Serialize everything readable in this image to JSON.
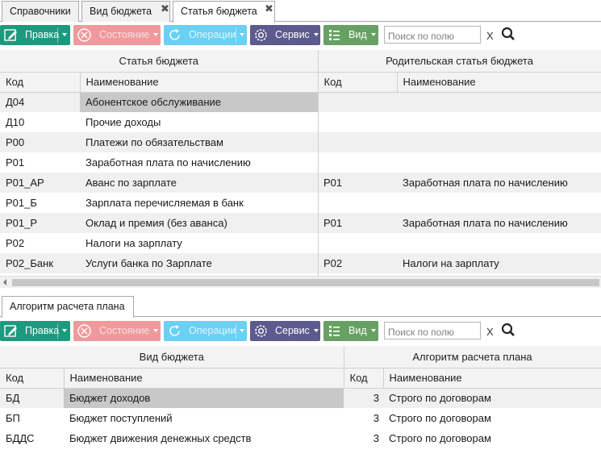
{
  "top_tabs": [
    {
      "label": "Справочники"
    },
    {
      "label": "Вид бюджета"
    },
    {
      "label": "Статья бюджета"
    }
  ],
  "toolbar": {
    "pravka": "Правка",
    "sostoyanie": "Состояние",
    "operatsii": "Операции",
    "servis": "Сервис",
    "vid": "Вид",
    "search_placeholder": "Поиск по полю",
    "clear": "X"
  },
  "colors": {
    "pravka": "#1d9a7e",
    "sostoyanie": "#ee9a9c",
    "operatsii": "#6ad0f4",
    "servis": "#5c5a8e",
    "vid": "#67a063"
  },
  "grid1": {
    "group_left": "Статья бюджета",
    "group_right": "Родительская статья бюджета",
    "col_code": "Код",
    "col_name": "Наименование",
    "col_pcode": "Код",
    "col_pname": "Наименование",
    "rows": [
      {
        "code": "Д04",
        "name": "Абонентское обслуживание",
        "pcode": "",
        "pname": ""
      },
      {
        "code": "Д10",
        "name": "Прочие доходы",
        "pcode": "",
        "pname": ""
      },
      {
        "code": "Р00",
        "name": "Платежи по обязательствам",
        "pcode": "",
        "pname": ""
      },
      {
        "code": "Р01",
        "name": "Заработная плата по начислению",
        "pcode": "",
        "pname": ""
      },
      {
        "code": "Р01_АР",
        "name": "Аванс по зарплате",
        "pcode": "Р01",
        "pname": "Заработная плата по начислению"
      },
      {
        "code": "Р01_Б",
        "name": "Зарплата перечисляемая в банк",
        "pcode": "",
        "pname": ""
      },
      {
        "code": "Р01_Р",
        "name": "Оклад и премия (без аванса)",
        "pcode": "Р01",
        "pname": "Заработная плата по начислению"
      },
      {
        "code": "Р02",
        "name": "Налоги на зарплату",
        "pcode": "",
        "pname": ""
      },
      {
        "code": "Р02_Банк",
        "name": "Услуги банка по Зарплате",
        "pcode": "Р02",
        "pname": "Налоги на зарплату"
      }
    ]
  },
  "bottom_tab": {
    "label": "Алгоритм расчета плана"
  },
  "grid2": {
    "group_left": "Вид бюджета",
    "group_right": "Алгоритм расчета плана",
    "col_code": "Код",
    "col_name": "Наименование",
    "col_acode": "Код",
    "col_aname": "Наименование",
    "rows": [
      {
        "code": "БД",
        "name": "Бюджет доходов",
        "acode": "3",
        "aname": "Строго по договорам"
      },
      {
        "code": "БП",
        "name": "Бюджет поступлений",
        "acode": "3",
        "aname": "Строго по договорам"
      },
      {
        "code": "БДДС",
        "name": "Бюджет движения денежных средств",
        "acode": "3",
        "aname": "Строго по договорам"
      }
    ]
  }
}
